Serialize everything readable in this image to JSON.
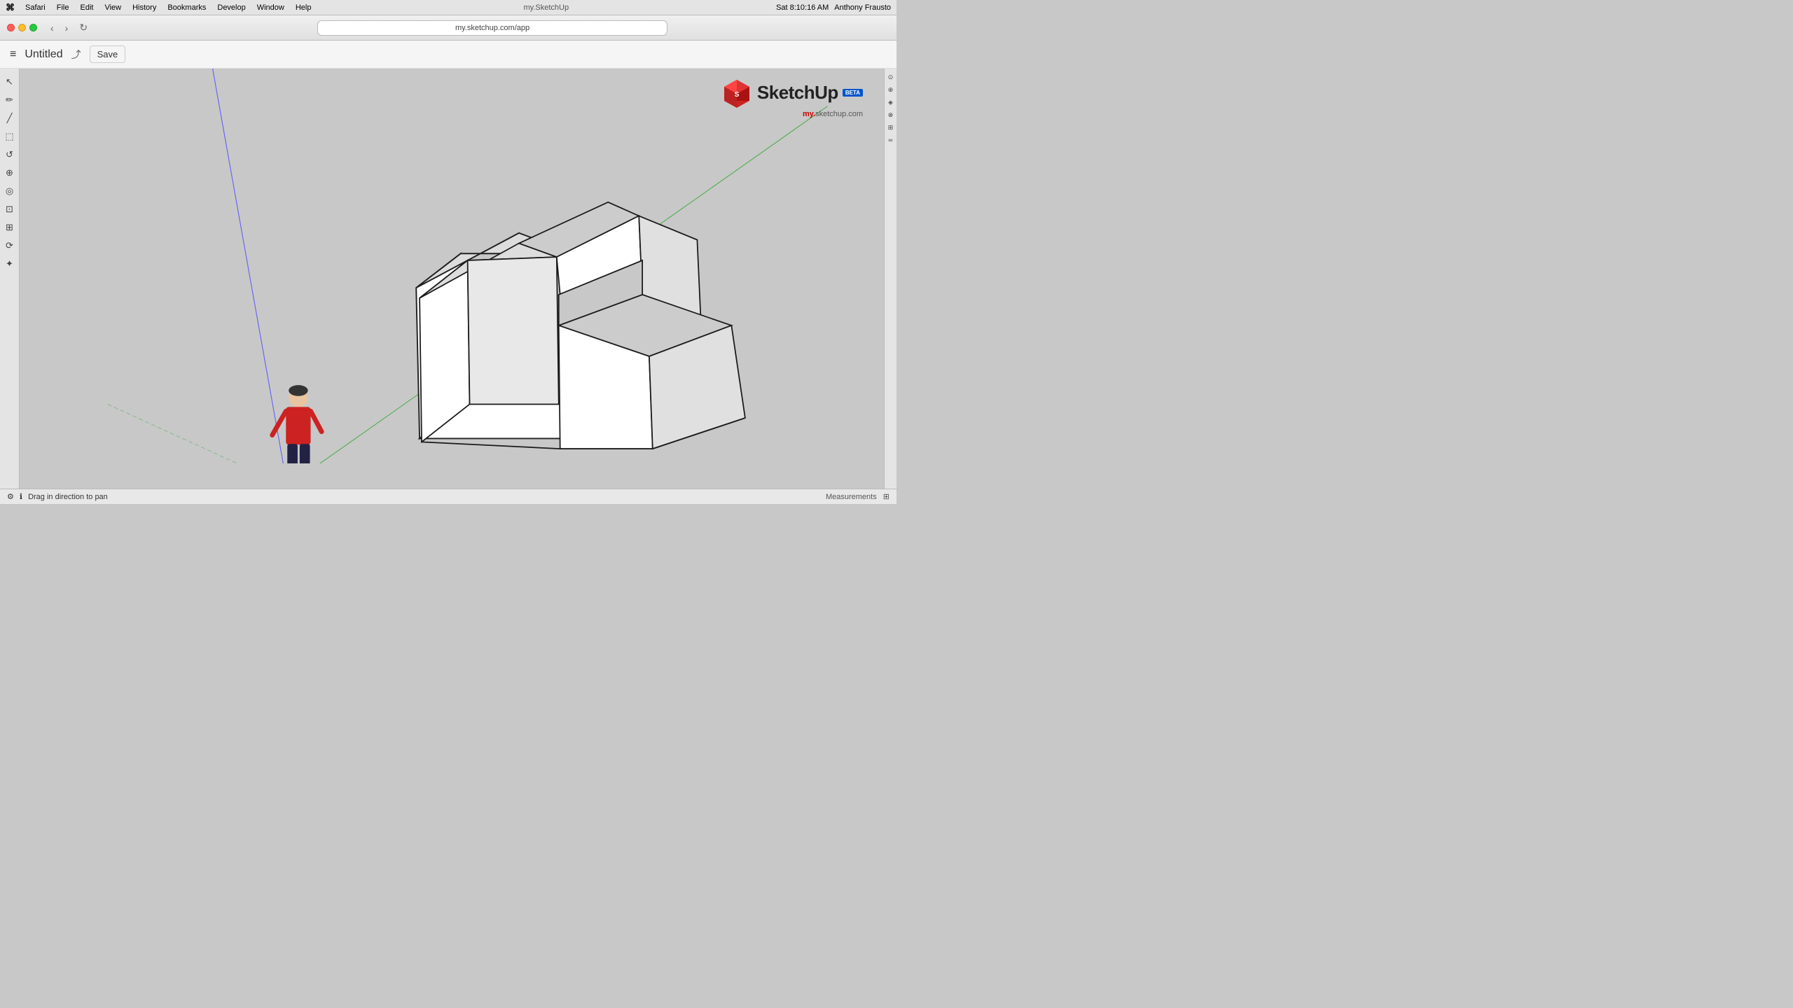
{
  "menubar": {
    "apple": "⌘",
    "app_name": "Safari",
    "items": [
      "File",
      "Edit",
      "View",
      "History",
      "Bookmarks",
      "Develop",
      "Window",
      "Help"
    ],
    "url": "my.sketchup.com/app",
    "tab_label": "my.SketchUp",
    "time": "Sat 8:10:16 AM",
    "user": "Anthony Frausto"
  },
  "app_toolbar": {
    "menu_icon": "≡",
    "title": "Untitled",
    "share_icon": "⎋",
    "save_label": "Save"
  },
  "tools": {
    "items": [
      "↖",
      "✏",
      "╱",
      "⬚",
      "↺",
      "⊕",
      "◎",
      "⊡",
      "⊞",
      "⟳",
      "✦"
    ]
  },
  "right_panel": {
    "items": [
      "⊙",
      "⊕",
      "◈",
      "⊗",
      "⊞",
      "∞"
    ]
  },
  "logo": {
    "name": "SketchUp",
    "beta": "BETA",
    "subtitle": "my.sketchup.com",
    "subtitle_highlight": "my."
  },
  "status_bar": {
    "info_icon": "ℹ",
    "message": "Drag in direction to pan",
    "measurements_label": "Measurements"
  },
  "canvas": {
    "axis": {
      "blue_start": [
        280,
        0
      ],
      "blue_end": [
        390,
        640
      ],
      "green_start": [
        450,
        520
      ],
      "green_end": [
        1180,
        80
      ],
      "red_start": [
        390,
        640
      ],
      "red_end": [
        730,
        780
      ]
    }
  }
}
